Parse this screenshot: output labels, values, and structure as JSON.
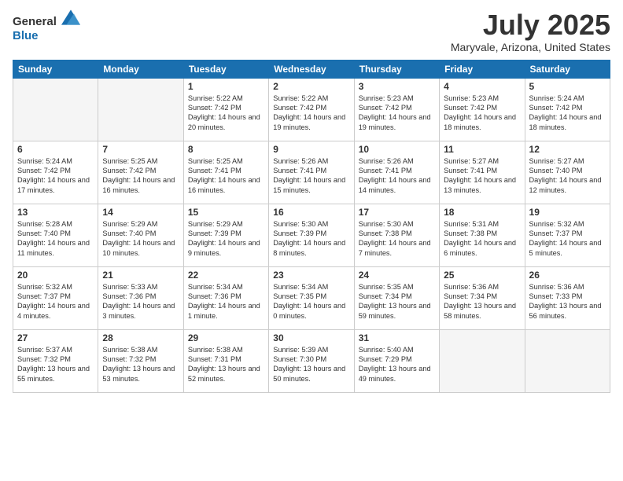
{
  "header": {
    "logo": {
      "general": "General",
      "blue": "Blue"
    },
    "title": "July 2025",
    "location": "Maryvale, Arizona, United States"
  },
  "weekdays": [
    "Sunday",
    "Monday",
    "Tuesday",
    "Wednesday",
    "Thursday",
    "Friday",
    "Saturday"
  ],
  "weeks": [
    [
      null,
      null,
      {
        "day": "1",
        "sunrise": "5:22 AM",
        "sunset": "7:42 PM",
        "daylight": "14 hours and 20 minutes."
      },
      {
        "day": "2",
        "sunrise": "5:22 AM",
        "sunset": "7:42 PM",
        "daylight": "14 hours and 19 minutes."
      },
      {
        "day": "3",
        "sunrise": "5:23 AM",
        "sunset": "7:42 PM",
        "daylight": "14 hours and 19 minutes."
      },
      {
        "day": "4",
        "sunrise": "5:23 AM",
        "sunset": "7:42 PM",
        "daylight": "14 hours and 18 minutes."
      },
      {
        "day": "5",
        "sunrise": "5:24 AM",
        "sunset": "7:42 PM",
        "daylight": "14 hours and 18 minutes."
      }
    ],
    [
      {
        "day": "6",
        "sunrise": "5:24 AM",
        "sunset": "7:42 PM",
        "daylight": "14 hours and 17 minutes."
      },
      {
        "day": "7",
        "sunrise": "5:25 AM",
        "sunset": "7:42 PM",
        "daylight": "14 hours and 16 minutes."
      },
      {
        "day": "8",
        "sunrise": "5:25 AM",
        "sunset": "7:41 PM",
        "daylight": "14 hours and 16 minutes."
      },
      {
        "day": "9",
        "sunrise": "5:26 AM",
        "sunset": "7:41 PM",
        "daylight": "14 hours and 15 minutes."
      },
      {
        "day": "10",
        "sunrise": "5:26 AM",
        "sunset": "7:41 PM",
        "daylight": "14 hours and 14 minutes."
      },
      {
        "day": "11",
        "sunrise": "5:27 AM",
        "sunset": "7:41 PM",
        "daylight": "14 hours and 13 minutes."
      },
      {
        "day": "12",
        "sunrise": "5:27 AM",
        "sunset": "7:40 PM",
        "daylight": "14 hours and 12 minutes."
      }
    ],
    [
      {
        "day": "13",
        "sunrise": "5:28 AM",
        "sunset": "7:40 PM",
        "daylight": "14 hours and 11 minutes."
      },
      {
        "day": "14",
        "sunrise": "5:29 AM",
        "sunset": "7:40 PM",
        "daylight": "14 hours and 10 minutes."
      },
      {
        "day": "15",
        "sunrise": "5:29 AM",
        "sunset": "7:39 PM",
        "daylight": "14 hours and 9 minutes."
      },
      {
        "day": "16",
        "sunrise": "5:30 AM",
        "sunset": "7:39 PM",
        "daylight": "14 hours and 8 minutes."
      },
      {
        "day": "17",
        "sunrise": "5:30 AM",
        "sunset": "7:38 PM",
        "daylight": "14 hours and 7 minutes."
      },
      {
        "day": "18",
        "sunrise": "5:31 AM",
        "sunset": "7:38 PM",
        "daylight": "14 hours and 6 minutes."
      },
      {
        "day": "19",
        "sunrise": "5:32 AM",
        "sunset": "7:37 PM",
        "daylight": "14 hours and 5 minutes."
      }
    ],
    [
      {
        "day": "20",
        "sunrise": "5:32 AM",
        "sunset": "7:37 PM",
        "daylight": "14 hours and 4 minutes."
      },
      {
        "day": "21",
        "sunrise": "5:33 AM",
        "sunset": "7:36 PM",
        "daylight": "14 hours and 3 minutes."
      },
      {
        "day": "22",
        "sunrise": "5:34 AM",
        "sunset": "7:36 PM",
        "daylight": "14 hours and 1 minute."
      },
      {
        "day": "23",
        "sunrise": "5:34 AM",
        "sunset": "7:35 PM",
        "daylight": "14 hours and 0 minutes."
      },
      {
        "day": "24",
        "sunrise": "5:35 AM",
        "sunset": "7:34 PM",
        "daylight": "13 hours and 59 minutes."
      },
      {
        "day": "25",
        "sunrise": "5:36 AM",
        "sunset": "7:34 PM",
        "daylight": "13 hours and 58 minutes."
      },
      {
        "day": "26",
        "sunrise": "5:36 AM",
        "sunset": "7:33 PM",
        "daylight": "13 hours and 56 minutes."
      }
    ],
    [
      {
        "day": "27",
        "sunrise": "5:37 AM",
        "sunset": "7:32 PM",
        "daylight": "13 hours and 55 minutes."
      },
      {
        "day": "28",
        "sunrise": "5:38 AM",
        "sunset": "7:32 PM",
        "daylight": "13 hours and 53 minutes."
      },
      {
        "day": "29",
        "sunrise": "5:38 AM",
        "sunset": "7:31 PM",
        "daylight": "13 hours and 52 minutes."
      },
      {
        "day": "30",
        "sunrise": "5:39 AM",
        "sunset": "7:30 PM",
        "daylight": "13 hours and 50 minutes."
      },
      {
        "day": "31",
        "sunrise": "5:40 AM",
        "sunset": "7:29 PM",
        "daylight": "13 hours and 49 minutes."
      },
      null,
      null
    ]
  ]
}
